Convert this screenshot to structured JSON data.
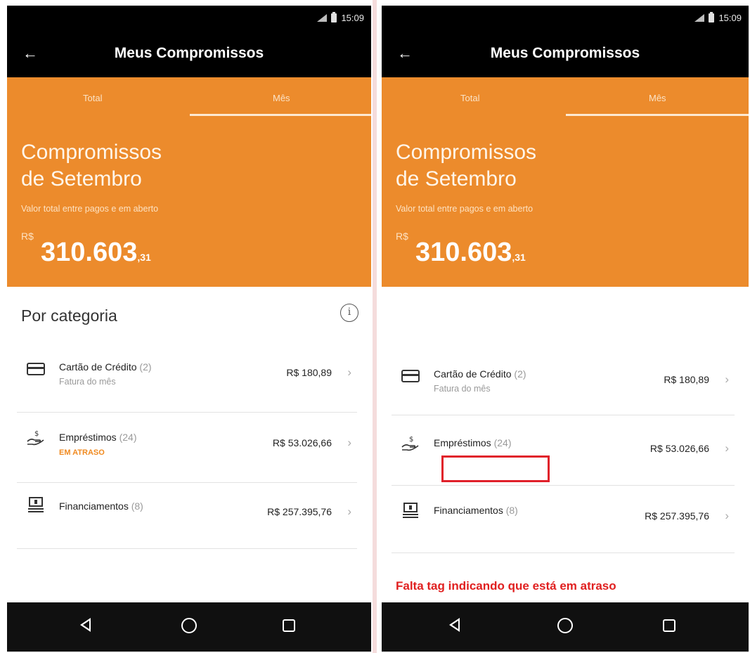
{
  "screens": [
    {
      "status_time": "15:09",
      "title": "Meus Compromissos",
      "tabs": [
        "Total",
        "Mês"
      ],
      "hero_title_line1": "Compromissos",
      "hero_title_line2": "de Setembro",
      "hero_subtitle": "Valor total entre pagos e em aberto",
      "currency": "R$",
      "amount_main": "310.603",
      "amount_cents": ",31",
      "section_title": "Por categoria",
      "rows": [
        {
          "icon": "credit-card-icon",
          "label": "Cartão de Crédito",
          "count": "(2)",
          "sub": "Fatura do mês",
          "tag": "",
          "value": "R$ 180,89"
        },
        {
          "icon": "loan-hand-icon",
          "label": "Empréstimos",
          "count": "(24)",
          "sub": "",
          "tag": "EM ATRASO",
          "value": "R$ 53.026,66"
        },
        {
          "icon": "financing-icon",
          "label": "Financiamentos",
          "count": "(8)",
          "sub": "",
          "tag": "",
          "value": "R$ 257.395,76"
        }
      ]
    },
    {
      "status_time": "15:09",
      "title": "Meus Compromissos",
      "tabs": [
        "Total",
        "Mês"
      ],
      "hero_title_line1": "Compromissos",
      "hero_title_line2": "de Setembro",
      "hero_subtitle": "Valor total entre pagos e em aberto",
      "currency": "R$",
      "amount_main": "310.603",
      "amount_cents": ",31",
      "rows": [
        {
          "icon": "credit-card-icon",
          "label": "Cartão de Crédito",
          "count": "(2)",
          "sub": "Fatura do mês",
          "value": "R$ 180,89"
        },
        {
          "icon": "loan-hand-icon",
          "label": "Empréstimos",
          "count": "(24)",
          "sub": "",
          "value": "R$ 53.026,66"
        },
        {
          "icon": "financing-icon",
          "label": "Financiamentos",
          "count": "(8)",
          "sub": "",
          "value": "R$ 257.395,76"
        }
      ],
      "annotation": "Falta tag indicando que está em atraso"
    }
  ],
  "colors": {
    "brand_orange": "#ec8b2c",
    "overdue_orange": "#f08a20",
    "annotation_red": "#e02020"
  }
}
